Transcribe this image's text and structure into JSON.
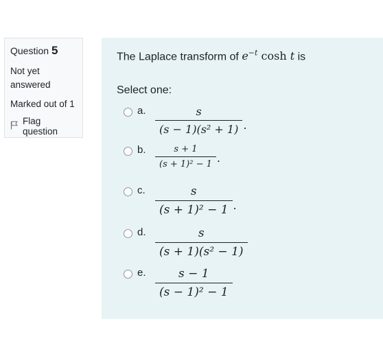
{
  "info": {
    "question_label": "Question",
    "question_number": "5",
    "state": "Not yet answered",
    "grade": "Marked out of 1",
    "flag_label": "Flag question"
  },
  "question": {
    "intro": "The Laplace transform of ",
    "exp_base": "e",
    "exp_power": "−t",
    "func": "cosh",
    "var": "t",
    "suffix": " is",
    "prompt": "Select one:"
  },
  "options": [
    {
      "letter": "a.",
      "numerator": "s",
      "denominator": "(s − 1)(s² + 1)",
      "trailing": "."
    },
    {
      "letter": "b.",
      "numerator": "s + 1",
      "denominator": "(s + 1)² − 1",
      "trailing": "."
    },
    {
      "letter": "c.",
      "numerator": "s",
      "denominator": "(s + 1)² − 1",
      "trailing": "."
    },
    {
      "letter": "d.",
      "numerator": "s",
      "denominator": "(s + 1)(s² − 1)",
      "trailing": ""
    },
    {
      "letter": "e.",
      "numerator": "s − 1",
      "denominator": "(s − 1)² − 1",
      "trailing": ""
    }
  ],
  "colors": {
    "panel_bg": "#e7f3f5",
    "info_bg": "#f8f9fa",
    "text": "#1d2125"
  }
}
